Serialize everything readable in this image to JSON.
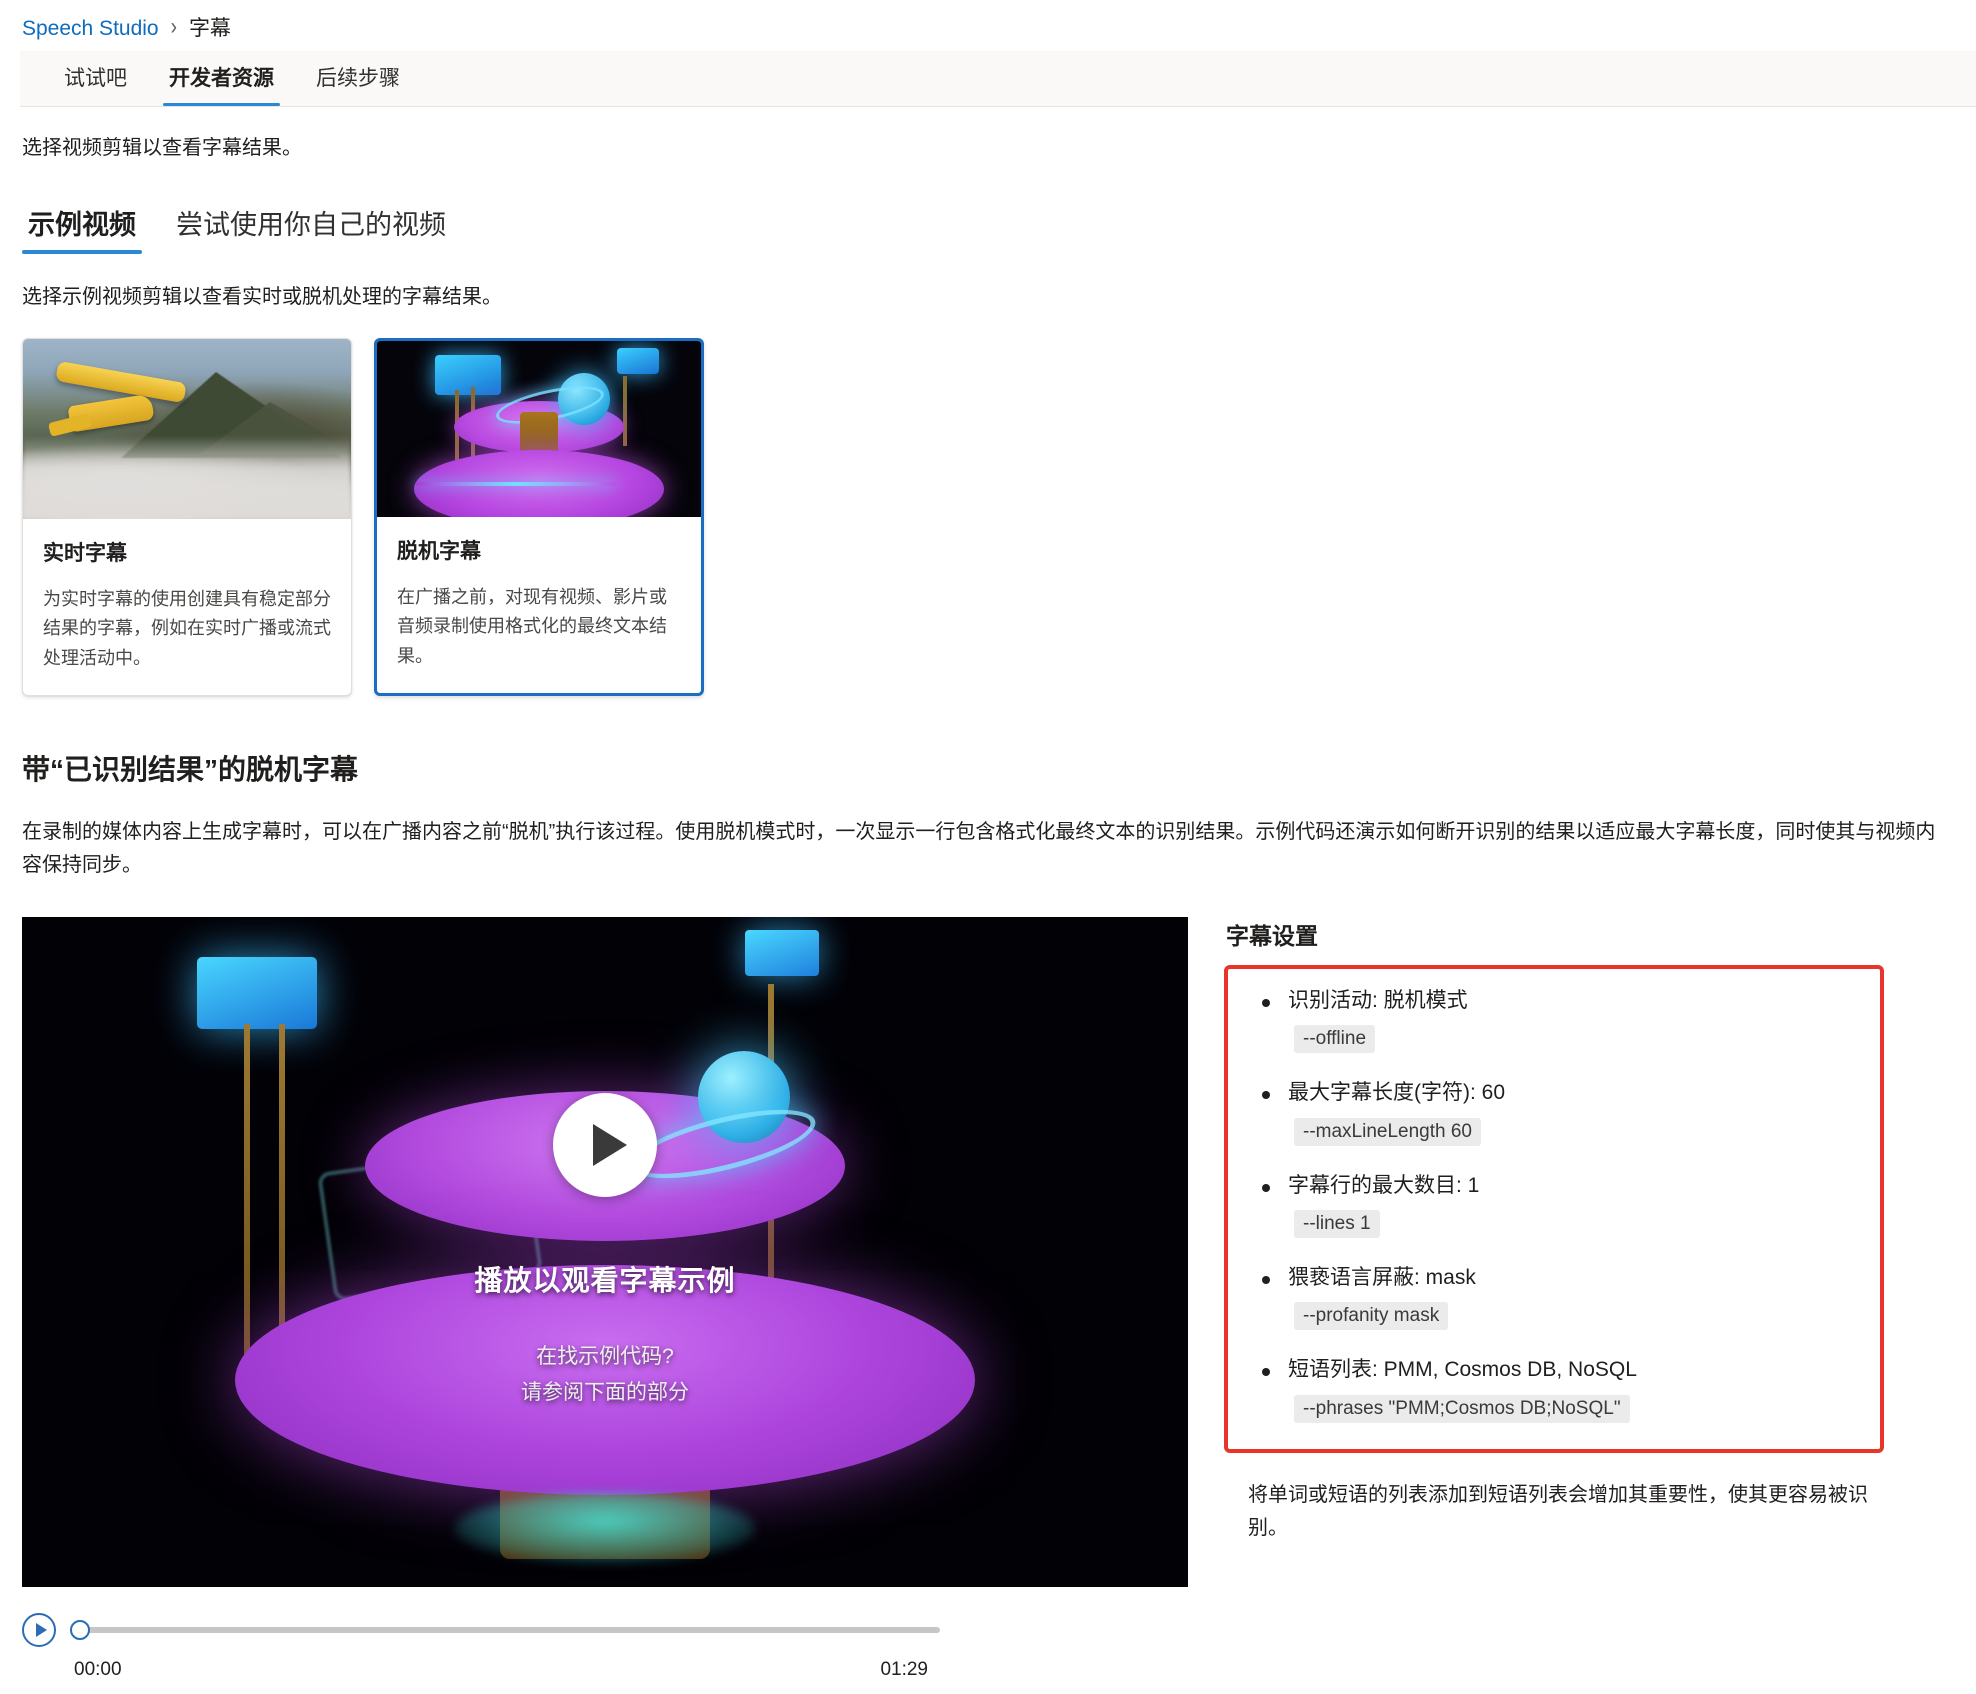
{
  "breadcrumb": {
    "root": "Speech Studio",
    "separator": "›",
    "current": "字幕"
  },
  "top_tabs": [
    {
      "label": "试试吧",
      "active": false
    },
    {
      "label": "开发者资源",
      "active": true
    },
    {
      "label": "后续步骤",
      "active": false
    }
  ],
  "intro": "选择视频剪辑以查看字幕结果。",
  "sub_tabs": [
    {
      "label": "示例视频",
      "active": true
    },
    {
      "label": "尝试使用你自己的视频",
      "active": false
    }
  ],
  "sub_desc": "选择示例视频剪辑以查看实时或脱机处理的字幕结果。",
  "cards": [
    {
      "title": "实时字幕",
      "desc": "为实时字幕的使用创建具有稳定部分结果的字幕，例如在实时广播或流式处理活动中。",
      "selected": false,
      "thumb": "airplane-over-mountains-thumbnail"
    },
    {
      "title": "脱机字幕",
      "desc": "在广播之前，对现有视频、影片或音频录制使用格式化的最终文本结果。",
      "selected": true,
      "thumb": "neon-carousel-thumbnail"
    }
  ],
  "section": {
    "heading": "带“已识别结果”的脱机字幕",
    "paragraph": "在录制的媒体内容上生成字幕时，可以在广播内容之前“脱机”执行该过程。使用脱机模式时，一次显示一行包含格式化最终文本的识别结果。示例代码还演示如何断开识别的结果以适应最大字幕长度，同时使其与视频内容保持同步。"
  },
  "player": {
    "overlay_title": "播放以观看字幕示例",
    "overlay_sub_line1": "在找示例代码?",
    "overlay_sub_line2": "请参阅下面的部分",
    "play_icon": "play-icon"
  },
  "transport": {
    "play_icon": "play-icon",
    "current_time": "00:00",
    "duration": "01:29",
    "progress_percent": 0
  },
  "settings": {
    "heading": "字幕设置",
    "highlight_color": "#e8352b",
    "items": [
      {
        "label": "识别活动: 脱机模式",
        "code": "--offline"
      },
      {
        "label": "最大字幕长度(字符): 60",
        "code": "--maxLineLength 60"
      },
      {
        "label": "字幕行的最大数目: 1",
        "code": "--lines 1"
      },
      {
        "label": "猥亵语言屏蔽: mask",
        "code": "--profanity mask"
      },
      {
        "label": "短语列表: PMM, Cosmos DB, NoSQL",
        "code": "--phrases \"PMM;Cosmos DB;NoSQL\""
      }
    ],
    "note": "将单词或短语的列表添加到短语列表会增加其重要性，使其更容易被识别。"
  },
  "theme": {
    "link_blue": "#0f6cbd",
    "tab_accent": "#2b88d8",
    "selected_border": "#1b6ec2"
  }
}
